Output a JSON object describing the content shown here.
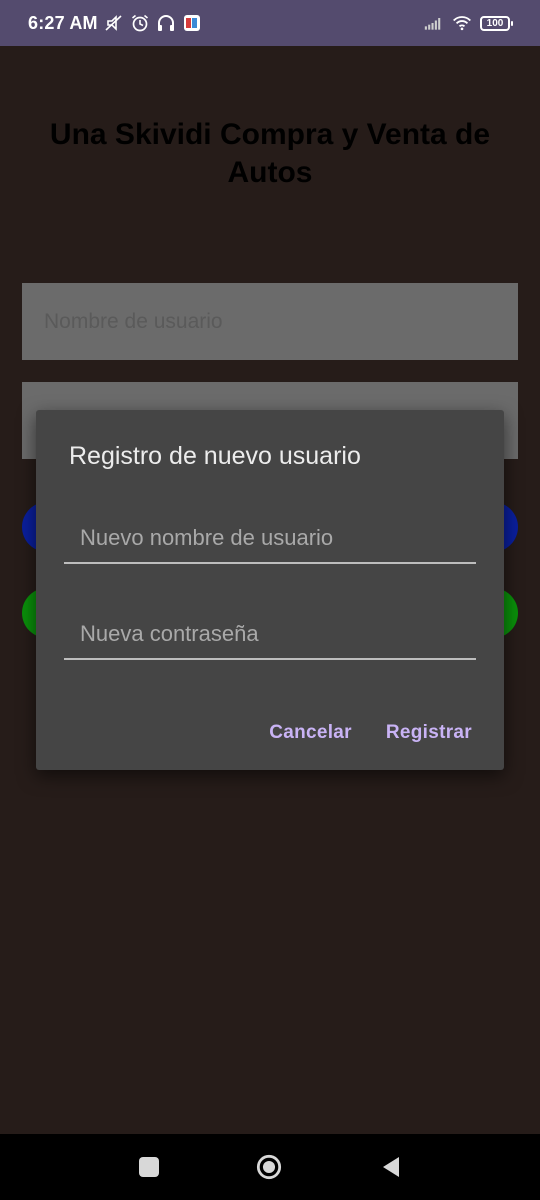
{
  "status_bar": {
    "time": "6:27 AM",
    "battery": "100",
    "icons": [
      "mute-icon",
      "alarm-icon",
      "headphones-icon",
      "app-notification-icon",
      "signal-icon",
      "wifi-icon",
      "battery-icon"
    ]
  },
  "app": {
    "title": "Una Skividi Compra y Venta de Autos",
    "username_placeholder": "Nombre de usuario",
    "password_placeholder": "",
    "colors": {
      "background": "#261c19",
      "input_bg": "#6b6b6b",
      "button_blue": "#0a1f9c",
      "button_green": "#0a8f0a"
    }
  },
  "dialog": {
    "title": "Registro de nuevo usuario",
    "new_username_placeholder": "Nuevo nombre de usuario",
    "new_password_placeholder": "Nueva contraseña",
    "cancel_label": "Cancelar",
    "register_label": "Registrar",
    "colors": {
      "surface": "#454545",
      "accent": "#c9b3f5"
    }
  },
  "nav_bar": {
    "icons": [
      "recent-apps-icon",
      "home-icon",
      "back-icon"
    ]
  }
}
